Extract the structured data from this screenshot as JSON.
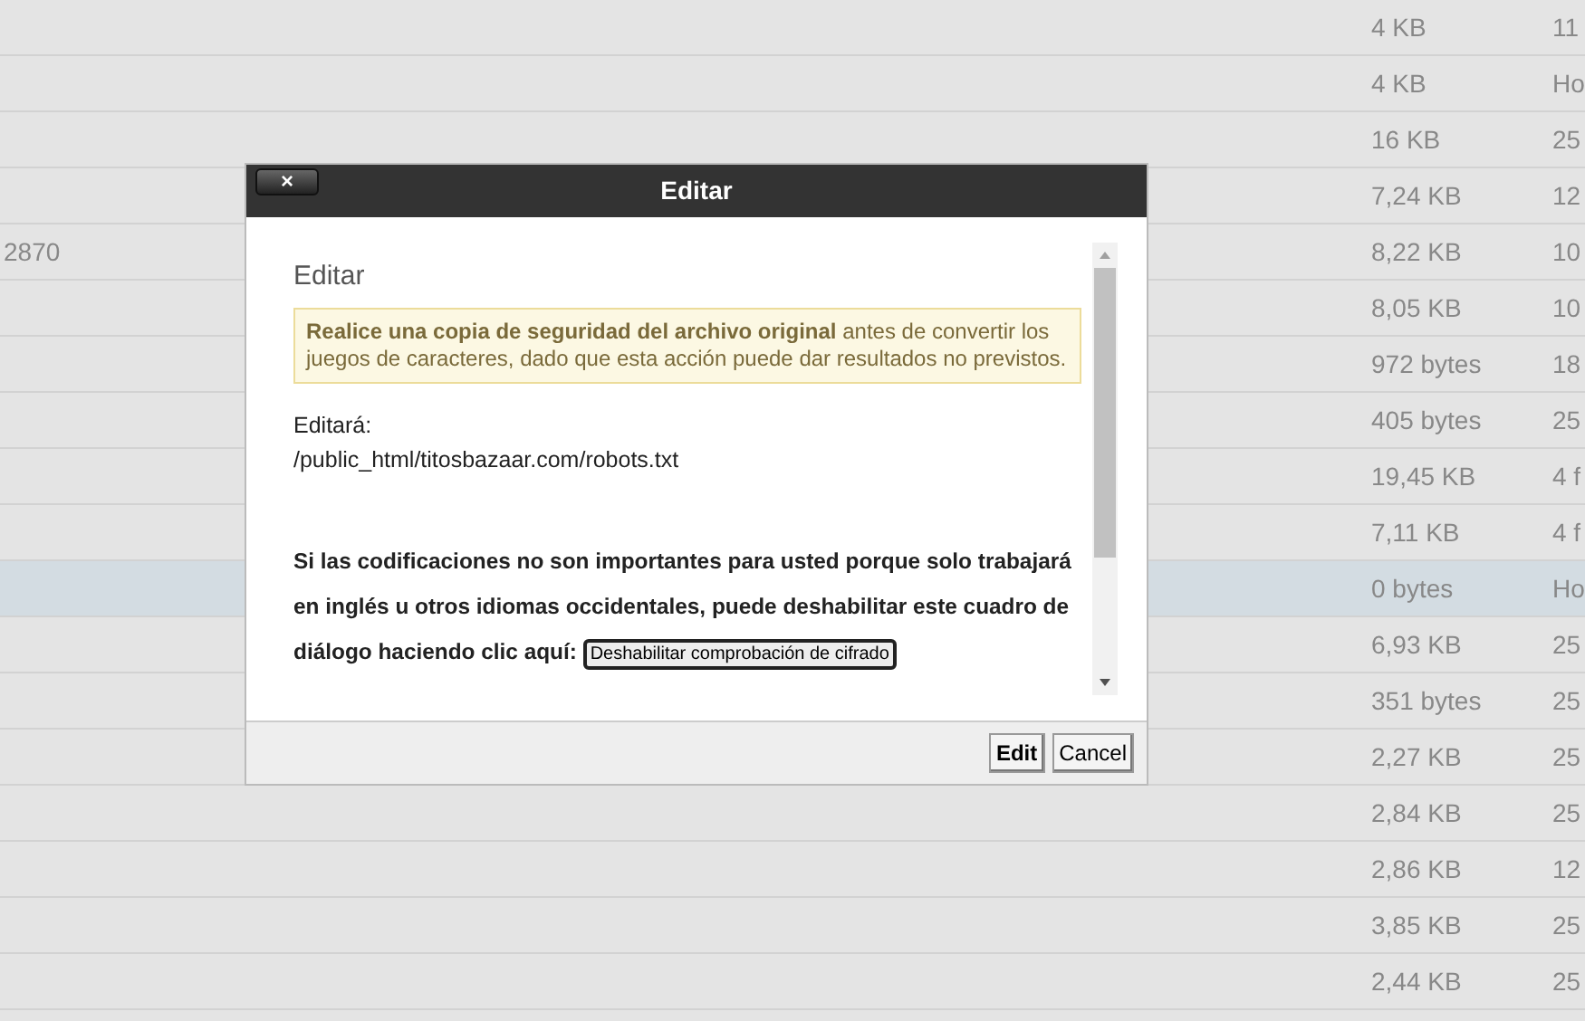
{
  "file_table": {
    "rows": [
      {
        "column_1": "",
        "size": "4 KB",
        "date": "11",
        "selected": false
      },
      {
        "column_1": "",
        "size": "4 KB",
        "date": "Ho",
        "selected": false
      },
      {
        "column_1": "",
        "size": "16 KB",
        "date": "25",
        "selected": false
      },
      {
        "column_1": "",
        "size": "7,24 KB",
        "date": "12",
        "selected": false
      },
      {
        "column_1": "2870",
        "size": "8,22 KB",
        "date": "10",
        "selected": false
      },
      {
        "column_1": "",
        "size": "8,05 KB",
        "date": "10",
        "selected": false
      },
      {
        "column_1": "",
        "size": "972 bytes",
        "date": "18",
        "selected": false
      },
      {
        "column_1": "",
        "size": "405 bytes",
        "date": "25",
        "selected": false
      },
      {
        "column_1": "",
        "size": "19,45 KB",
        "date": "4 f",
        "selected": false
      },
      {
        "column_1": "",
        "size": "7,11 KB",
        "date": "4 f",
        "selected": false
      },
      {
        "column_1": "",
        "size": "0 bytes",
        "date": "Ho",
        "selected": true
      },
      {
        "column_1": "",
        "size": "6,93 KB",
        "date": "25",
        "selected": false
      },
      {
        "column_1": "",
        "size": "351 bytes",
        "date": "25",
        "selected": false
      },
      {
        "column_1": "",
        "size": "2,27 KB",
        "date": "25",
        "selected": false
      },
      {
        "column_1": "",
        "size": "2,84 KB",
        "date": "25",
        "selected": false
      },
      {
        "column_1": "",
        "size": "2,86 KB",
        "date": "12",
        "selected": false
      },
      {
        "column_1": "",
        "size": "3,85 KB",
        "date": "25",
        "selected": false
      },
      {
        "column_1": "",
        "size": "2,44 KB",
        "date": "25",
        "selected": false
      }
    ]
  },
  "dialog": {
    "title": "Editar",
    "close_label": "×",
    "heading": "Editar",
    "warning": "**Realice una copia de seguridad del archivo original** antes de convertir los juegos de caracteres, dado que esta acción puede dar resultados no previstos.",
    "editing_label": "Editará:",
    "file_path": "/public_html/titosbazaar.com/robots.txt",
    "info_text": "Si las codificaciones no son importantes para usted porque solo trabajará en inglés u otros idiomas occidentales, puede deshabilitar este cuadro de",
    "info_text_end": "diálogo haciendo clic aquí:",
    "disable_button": "Deshabilitar comprobación de cifrado",
    "buttons": [
      "Edit",
      "Cancel"
    ]
  }
}
